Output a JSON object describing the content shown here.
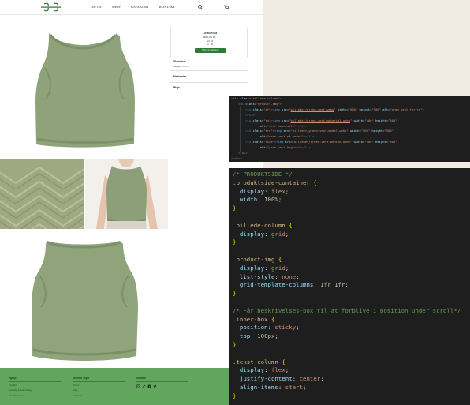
{
  "colors": {
    "accent": "#2f6b32",
    "footer": "#62a55c",
    "button": "#2c7b38",
    "editor_bg": "#1e1e1e",
    "backdrop": "#f1ebe4"
  },
  "nav": {
    "items": [
      "OM OS",
      "SHOP",
      "GAVEKORT",
      "KONTAKT"
    ],
    "search_icon": "search-icon",
    "cart_icon": "cart-icon"
  },
  "product": {
    "name": "Grøn vest",
    "price": "800,00 kr.",
    "size": "Str: M",
    "sku": "Nr.: 35",
    "cart_button": "Tilføj til indkøbskurv"
  },
  "accordion": [
    {
      "title": "Størrelse",
      "sub": "Længde: ca. cm"
    },
    {
      "title": "Materialer",
      "sub": ""
    },
    {
      "title": "Pleje",
      "sub": ""
    }
  ],
  "footer": {
    "col1": {
      "title": "Hjælp",
      "links": [
        "Kontakt",
        "Levering & Returnering",
        "Privatlivspolitik"
      ]
    },
    "col2": {
      "title": "Second Style",
      "links": [
        "Om os",
        "Shop",
        "Gavekort"
      ]
    },
    "col3": {
      "title": "Socials"
    },
    "social_icons": [
      "instagram-icon",
      "tiktok-icon",
      "facebook-icon",
      "twitter-icon"
    ]
  },
  "html_code": [
    [
      [
        "tagp",
        "<"
      ],
      [
        "tag",
        "div"
      ],
      [
        "txt",
        " "
      ],
      [
        "attr",
        "class"
      ],
      [
        "pun",
        "="
      ],
      [
        "str",
        "\"billede-column\""
      ],
      [
        "tagp",
        ">"
      ]
    ],
    [
      [
        "txt",
        "    "
      ],
      [
        "tagp",
        "<"
      ],
      [
        "tag",
        "ul"
      ],
      [
        "txt",
        " "
      ],
      [
        "attr",
        "class"
      ],
      [
        "pun",
        "="
      ],
      [
        "str",
        "\"product-img\""
      ],
      [
        "tagp",
        ">"
      ]
    ],
    [
      [
        "txt",
        "        "
      ],
      [
        "tagp",
        "<"
      ],
      [
        "tag",
        "li"
      ],
      [
        "txt",
        " "
      ],
      [
        "attr",
        "class"
      ],
      [
        "pun",
        "="
      ],
      [
        "str",
        "\"af\""
      ],
      [
        "tagp",
        "><"
      ],
      [
        "tag",
        "img"
      ],
      [
        "txt",
        " "
      ],
      [
        "attr",
        "src"
      ],
      [
        "pun",
        "="
      ],
      [
        "str",
        "\""
      ],
      [
        "url",
        "billeder/green-vest.webp"
      ],
      [
        "str",
        "\""
      ],
      [
        "txt",
        " "
      ],
      [
        "attr",
        "width"
      ],
      [
        "pun",
        "="
      ],
      [
        "str",
        "\"500\""
      ],
      [
        "txt",
        " "
      ],
      [
        "attr",
        "height"
      ],
      [
        "pun",
        "="
      ],
      [
        "str",
        "\"500\""
      ],
      [
        "txt",
        " "
      ],
      [
        "attr",
        "alt"
      ],
      [
        "pun",
        "="
      ],
      [
        "str",
        "\"grøn vest forfra\""
      ],
      [
        "tagp",
        ">"
      ]
    ],
    [
      [
        "txt",
        "        "
      ],
      [
        "tagp",
        "</"
      ],
      [
        "tag",
        "li"
      ],
      [
        "tagp",
        ">"
      ]
    ],
    [
      [
        "txt",
        "        "
      ],
      [
        "tagp",
        "<"
      ],
      [
        "tag",
        "li"
      ],
      [
        "txt",
        " "
      ],
      [
        "attr",
        "class"
      ],
      [
        "pun",
        "="
      ],
      [
        "str",
        "\"tu\""
      ],
      [
        "tagp",
        "><"
      ],
      [
        "tag",
        "img"
      ],
      [
        "txt",
        " "
      ],
      [
        "attr",
        "src"
      ],
      [
        "pun",
        "="
      ],
      [
        "str",
        "\""
      ],
      [
        "url",
        "billeder/green-vest-material.webp"
      ],
      [
        "str",
        "\""
      ],
      [
        "txt",
        " "
      ],
      [
        "attr",
        "width"
      ],
      [
        "pun",
        "="
      ],
      [
        "str",
        "\"500\""
      ],
      [
        "txt",
        " "
      ],
      [
        "attr",
        "height"
      ],
      [
        "pun",
        "="
      ],
      [
        "str",
        "\"500\""
      ]
    ],
    [
      [
        "txt",
        "                "
      ],
      [
        "attr",
        "alt"
      ],
      [
        "pun",
        "="
      ],
      [
        "str",
        "\"vest materiale\""
      ],
      [
        "tagp",
        "></"
      ],
      [
        "tag",
        "li"
      ],
      [
        "tagp",
        ">"
      ]
    ],
    [
      [
        "txt",
        "        "
      ],
      [
        "tagp",
        "<"
      ],
      [
        "tag",
        "li"
      ],
      [
        "txt",
        " "
      ],
      [
        "attr",
        "class"
      ],
      [
        "pun",
        "="
      ],
      [
        "str",
        "\"tre\""
      ],
      [
        "tagp",
        "><"
      ],
      [
        "tag",
        "img"
      ],
      [
        "txt",
        " "
      ],
      [
        "attr",
        "src"
      ],
      [
        "pun",
        "="
      ],
      [
        "str",
        "\""
      ],
      [
        "url",
        "billeder/green-vest-model.webp"
      ],
      [
        "str",
        "\""
      ],
      [
        "txt",
        " "
      ],
      [
        "attr",
        "width"
      ],
      [
        "pun",
        "="
      ],
      [
        "str",
        "\"500\""
      ],
      [
        "txt",
        " "
      ],
      [
        "attr",
        "height"
      ],
      [
        "pun",
        "="
      ],
      [
        "str",
        "\"500\""
      ]
    ],
    [
      [
        "txt",
        "                "
      ],
      [
        "attr",
        "alt"
      ],
      [
        "pun",
        "="
      ],
      [
        "str",
        "\"grøn vest på model\""
      ],
      [
        "tagp",
        "></"
      ],
      [
        "tag",
        "li"
      ],
      [
        "tagp",
        ">"
      ]
    ],
    [
      [
        "txt",
        "        "
      ],
      [
        "tagp",
        "<"
      ],
      [
        "tag",
        "li"
      ],
      [
        "txt",
        " "
      ],
      [
        "attr",
        "class"
      ],
      [
        "pun",
        "="
      ],
      [
        "str",
        "\"fire\""
      ],
      [
        "tagp",
        "><"
      ],
      [
        "tag",
        "img"
      ],
      [
        "txt",
        " "
      ],
      [
        "attr",
        "src"
      ],
      [
        "pun",
        "="
      ],
      [
        "str",
        "\""
      ],
      [
        "url",
        "billeder/green-vest-behind.webp"
      ],
      [
        "str",
        "\""
      ],
      [
        "txt",
        " "
      ],
      [
        "attr",
        "width"
      ],
      [
        "pun",
        "="
      ],
      [
        "str",
        "\"500\""
      ],
      [
        "txt",
        " "
      ],
      [
        "attr",
        "height"
      ],
      [
        "pun",
        "="
      ],
      [
        "str",
        "\"500\""
      ]
    ],
    [
      [
        "txt",
        "                "
      ],
      [
        "attr",
        "alt"
      ],
      [
        "pun",
        "="
      ],
      [
        "str",
        "\"grøn vest bagfra\""
      ],
      [
        "tagp",
        "></"
      ],
      [
        "tag",
        "li"
      ],
      [
        "tagp",
        ">"
      ]
    ],
    [
      [
        "txt",
        "    "
      ],
      [
        "tagp",
        "</"
      ],
      [
        "tag",
        "ul"
      ],
      [
        "tagp",
        ">"
      ]
    ],
    [
      [
        "tagp",
        "</"
      ],
      [
        "tag",
        "div"
      ],
      [
        "tagp",
        ">"
      ]
    ]
  ],
  "css_code": [
    [
      [
        "cmt",
        "/* PRODUKTSIDE */"
      ]
    ],
    [
      [
        "sel",
        ".produktside-container"
      ],
      [
        "txt",
        " "
      ],
      [
        "brk",
        "{"
      ]
    ],
    [
      [
        "txt",
        "  "
      ],
      [
        "prop",
        "display"
      ],
      [
        "pun",
        ": "
      ],
      [
        "val",
        "flex"
      ],
      [
        "pun",
        ";"
      ]
    ],
    [
      [
        "txt",
        "  "
      ],
      [
        "prop",
        "width"
      ],
      [
        "pun",
        ": "
      ],
      [
        "num",
        "100%"
      ],
      [
        "pun",
        ";"
      ]
    ],
    [
      [
        "brk",
        "}"
      ]
    ],
    [],
    [
      [
        "sel",
        ".billede-column"
      ],
      [
        "txt",
        " "
      ],
      [
        "brk",
        "{"
      ]
    ],
    [
      [
        "txt",
        "  "
      ],
      [
        "prop",
        "display"
      ],
      [
        "pun",
        ": "
      ],
      [
        "val",
        "grid"
      ],
      [
        "pun",
        ";"
      ]
    ],
    [
      [
        "brk",
        "}"
      ]
    ],
    [],
    [
      [
        "sel",
        ".product-img"
      ],
      [
        "txt",
        " "
      ],
      [
        "brk",
        "{"
      ]
    ],
    [
      [
        "txt",
        "  "
      ],
      [
        "prop",
        "display"
      ],
      [
        "pun",
        ": "
      ],
      [
        "val",
        "grid"
      ],
      [
        "pun",
        ";"
      ]
    ],
    [
      [
        "txt",
        "  "
      ],
      [
        "prop",
        "list-style"
      ],
      [
        "pun",
        ": "
      ],
      [
        "val",
        "none"
      ],
      [
        "pun",
        ";"
      ]
    ],
    [
      [
        "txt",
        "  "
      ],
      [
        "prop",
        "grid-template-columns"
      ],
      [
        "pun",
        ": "
      ],
      [
        "num",
        "1fr 1fr"
      ],
      [
        "pun",
        ";"
      ]
    ],
    [
      [
        "brk",
        "}"
      ]
    ],
    [],
    [
      [
        "cmt",
        "/* Får beskrivelses-box til at forblive i position under scroll*/"
      ]
    ],
    [
      [
        "sel",
        ".inner-box"
      ],
      [
        "txt",
        " "
      ],
      [
        "brk",
        "{"
      ]
    ],
    [
      [
        "txt",
        "  "
      ],
      [
        "prop",
        "position"
      ],
      [
        "pun",
        ": "
      ],
      [
        "val",
        "sticky"
      ],
      [
        "pun",
        ";"
      ]
    ],
    [
      [
        "txt",
        "  "
      ],
      [
        "prop",
        "top"
      ],
      [
        "pun",
        ": "
      ],
      [
        "num",
        "100px"
      ],
      [
        "pun",
        ";"
      ]
    ],
    [
      [
        "brk",
        "}"
      ]
    ],
    [],
    [
      [
        "sel",
        ".tekst-column"
      ],
      [
        "txt",
        " "
      ],
      [
        "brk",
        "{"
      ]
    ],
    [
      [
        "txt",
        "  "
      ],
      [
        "prop",
        "display"
      ],
      [
        "pun",
        ": "
      ],
      [
        "val",
        "flex"
      ],
      [
        "pun",
        ";"
      ]
    ],
    [
      [
        "txt",
        "  "
      ],
      [
        "prop",
        "justify-content"
      ],
      [
        "pun",
        ": "
      ],
      [
        "val",
        "center"
      ],
      [
        "pun",
        ";"
      ]
    ],
    [
      [
        "txt",
        "  "
      ],
      [
        "prop",
        "align-items"
      ],
      [
        "pun",
        ": "
      ],
      [
        "val",
        "start"
      ],
      [
        "pun",
        ";"
      ]
    ],
    [
      [
        "brk",
        "}"
      ]
    ]
  ]
}
